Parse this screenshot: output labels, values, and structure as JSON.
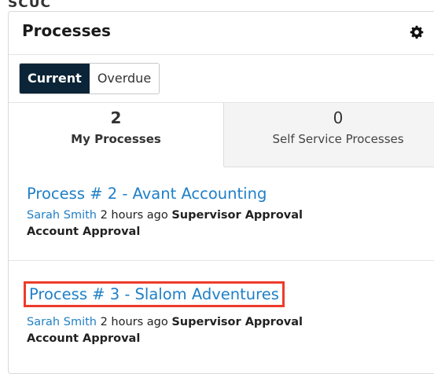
{
  "clipped_header": "SCUC",
  "dashlet": {
    "title": "Processes",
    "gear_icon": "gear-icon"
  },
  "toggle": {
    "current": "Current",
    "overdue": "Overdue"
  },
  "tabs": [
    {
      "count": "2",
      "label": "My Processes"
    },
    {
      "count": "0",
      "label": "Self Service Processes"
    }
  ],
  "processes": [
    {
      "title": "Process # 2 - Avant Accounting",
      "user": "Sarah Smith",
      "time": "2 hours ago",
      "activity": "Supervisor Approval",
      "definition": "Account Approval"
    },
    {
      "title": "Process # 3 - Slalom Adventures",
      "user": "Sarah Smith",
      "time": "2 hours ago",
      "activity": "Supervisor Approval",
      "definition": "Account Approval"
    }
  ],
  "colors": {
    "accent": "#0b2437",
    "link": "#1f7fc6",
    "highlight": "#ee3b2b"
  }
}
